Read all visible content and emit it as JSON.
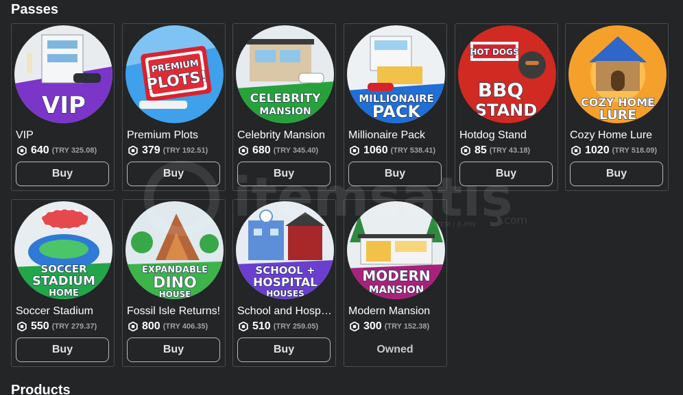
{
  "sections": {
    "passes_title": "Passes",
    "products_title": "Products"
  },
  "currency_icon": "robux-icon",
  "passes": [
    {
      "name": "VIP",
      "price": "640",
      "try": "(TRY 325.08)",
      "action": "Buy",
      "art_text": [
        "VIP"
      ],
      "bg": "#7b35c9"
    },
    {
      "name": "Premium Plots",
      "price": "379",
      "try": "(TRY 192.51)",
      "action": "Buy",
      "art_text": [
        "PREMIUM",
        "PLOTS!"
      ],
      "bg": "#2e8de0"
    },
    {
      "name": "Celebrity Mansion",
      "price": "680",
      "try": "(TRY 345.40)",
      "action": "Buy",
      "art_text": [
        "CELEBRITY",
        "MANSION"
      ],
      "bg": "#27a23a"
    },
    {
      "name": "Millionaire Pack",
      "price": "1060",
      "try": "(TRY 538.41)",
      "action": "Buy",
      "art_text": [
        "MILLIONAIRE",
        "PACK"
      ],
      "bg": "#1f6fd6"
    },
    {
      "name": "Hotdog Stand",
      "price": "85",
      "try": "(TRY 43.18)",
      "action": "Buy",
      "art_text": [
        "HOT DOGS",
        "BBQ",
        "STAND"
      ],
      "bg": "#d02a22"
    },
    {
      "name": "Cozy Home Lure",
      "price": "1020",
      "try": "(TRY 518.09)",
      "action": "Buy",
      "art_text": [
        "COZY HOME",
        "LURE"
      ],
      "bg": "#f08a1c"
    },
    {
      "name": "Soccer Stadium",
      "price": "550",
      "try": "(TRY 279.37)",
      "action": "Buy",
      "art_text": [
        "SOCCER",
        "STADIUM",
        "HOME"
      ],
      "bg": "#22a64a"
    },
    {
      "name": "Fossil Isle Returns!",
      "price": "800",
      "try": "(TRY 406.35)",
      "action": "Buy",
      "art_text": [
        "EXPANDABLE",
        "DINO",
        "HOUSE"
      ],
      "bg": "#3cb44a"
    },
    {
      "name": "School and Hospital Houses",
      "price": "510",
      "try": "(TRY 259.05)",
      "action": "Buy",
      "art_text": [
        "SCHOOL +",
        "HOSPITAL",
        "HOUSES"
      ],
      "bg": "#6a3fcf"
    },
    {
      "name": "Modern Mansion",
      "price": "300",
      "try": "(TRY 152.38)",
      "action": "Owned",
      "art_text": [
        "MODERN",
        "MANSION"
      ],
      "bg": "#a8227c"
    }
  ],
  "watermark": {
    "brand": "itemsatış",
    "sub": "HESAP / İTEM / E-PİN",
    "tld": ".com"
  }
}
